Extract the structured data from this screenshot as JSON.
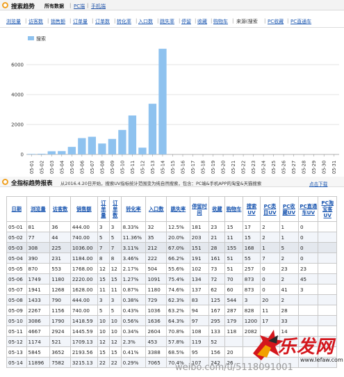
{
  "header": {
    "title": "搜索趋势",
    "sub_all": "所有数据",
    "sub_pc": "PC端",
    "sub_mobile": "手机端",
    "sep": "|"
  },
  "tabs": [
    {
      "label": "浏览量",
      "active": false
    },
    {
      "label": "访客数",
      "active": false
    },
    {
      "label": "销售额",
      "active": false
    },
    {
      "label": "订单量",
      "active": false
    },
    {
      "label": "订单数",
      "active": false
    },
    {
      "label": "转化率",
      "active": false
    },
    {
      "label": "入口数",
      "active": false
    },
    {
      "label": "跳失率",
      "active": false
    },
    {
      "label": "停留",
      "active": false
    },
    {
      "label": "收藏",
      "active": false
    },
    {
      "label": "购物车",
      "active": false
    },
    {
      "label": "来源(搜索",
      "active": true
    },
    {
      "label": "PC收藏",
      "active": false
    },
    {
      "label": "PC直通车",
      "active": false
    }
  ],
  "chart_data": {
    "type": "bar",
    "legend": [
      "搜索"
    ],
    "legend_position": "top-left",
    "ylim": [
      0,
      8000
    ],
    "yticks": [
      0,
      2000,
      4000,
      6000
    ],
    "grid": true,
    "bar_color": "#8ec2ef",
    "categories": [
      "05-01",
      "05-02",
      "05-03",
      "05-04",
      "05-05",
      "05-06",
      "05-07",
      "05-08",
      "05-09",
      "05-10",
      "05-11",
      "05-12",
      "05-13",
      "05-14",
      "05-15",
      "05-16",
      "05-17",
      "05-18",
      "05-19",
      "05-20",
      "05-21",
      "05-22",
      "05-23",
      "05-24",
      "05-25",
      "05-26",
      "05-27",
      "05-28",
      "05-29",
      "05-30",
      "05-31"
    ],
    "values": [
      32,
      44,
      212,
      222,
      504,
      1091,
      1180,
      729,
      1036,
      1636,
      2604,
      453,
      3388,
      7065,
      0,
      0,
      0,
      0,
      0,
      0,
      0,
      0,
      0,
      0,
      0,
      0,
      0,
      0,
      0,
      0,
      0
    ]
  },
  "section2": {
    "title": "全指标趋势报表",
    "note": "从2016.4.20日开始，搜索UV指标统计范围变为纯自然搜索，包含：PC端&手机APP的淘宝&天猫搜索",
    "download": "点击下载"
  },
  "table": {
    "headers": [
      "日期",
      "浏览量",
      "访客数",
      "销售额",
      "订单量",
      "订单数",
      "转化率",
      "入口数",
      "跳失率",
      "停留时间",
      "收藏",
      "购物车",
      "搜索UV",
      "PC类目UV",
      "PC收藏UV",
      "PC直通车UV",
      "PC淘宝客UV"
    ],
    "rows": [
      [
        "05-01",
        "81",
        "36",
        "444.00",
        "3",
        "3",
        "8.33%",
        "32",
        "12.5%",
        "181",
        "23",
        "15",
        "17",
        "2",
        "1",
        "0"
      ],
      [
        "05-02",
        "77",
        "44",
        "740.00",
        "5",
        "5",
        "11.36%",
        "35",
        "20.0%",
        "203",
        "21",
        "11",
        "15",
        "2",
        "1",
        "0"
      ],
      [
        "05-03",
        "308",
        "225",
        "1036.00",
        "7",
        "7",
        "3.11%",
        "212",
        "67.0%",
        "151",
        "28",
        "155",
        "168",
        "1",
        "5",
        "0"
      ],
      [
        "05-04",
        "390",
        "231",
        "1184.00",
        "8",
        "8",
        "3.46%",
        "222",
        "66.2%",
        "191",
        "161",
        "51",
        "55",
        "7",
        "2",
        "0"
      ],
      [
        "05-05",
        "870",
        "553",
        "1768.00",
        "12",
        "12",
        "2.17%",
        "504",
        "55.6%",
        "102",
        "73",
        "51",
        "257",
        "0",
        "23",
        "23"
      ],
      [
        "05-06",
        "1749",
        "1180",
        "2220.00",
        "15",
        "15",
        "1.27%",
        "1091",
        "75.4%",
        "134",
        "72",
        "70",
        "873",
        "0",
        "2",
        "45"
      ],
      [
        "05-07",
        "1941",
        "1268",
        "1628.00",
        "11",
        "11",
        "0.87%",
        "1180",
        "74.6%",
        "137",
        "62",
        "60",
        "873",
        "0",
        "41",
        "3"
      ],
      [
        "05-08",
        "1433",
        "790",
        "444.00",
        "3",
        "3",
        "0.38%",
        "729",
        "62.3%",
        "83",
        "125",
        "544",
        "3",
        "20",
        "2",
        ""
      ],
      [
        "05-09",
        "2267",
        "1156",
        "740.00",
        "5",
        "5",
        "0.43%",
        "1036",
        "63.2%",
        "94",
        "167",
        "287",
        "828",
        "11",
        "28",
        ""
      ],
      [
        "05-10",
        "3086",
        "1790",
        "1418.59",
        "10",
        "10",
        "0.56%",
        "1636",
        "64.3%",
        "97",
        "295",
        "179",
        "1200",
        "17",
        "33",
        ""
      ],
      [
        "05-11",
        "4667",
        "2924",
        "1445.59",
        "10",
        "10",
        "0.34%",
        "2604",
        "70.8%",
        "108",
        "133",
        "118",
        "2082",
        "",
        "14",
        ""
      ],
      [
        "05-12",
        "1174",
        "521",
        "1709.13",
        "12",
        "12",
        "2.3%",
        "453",
        "57.8%",
        "119",
        "52",
        "",
        "",
        "",
        "",
        "",
        ""
      ],
      [
        "05-13",
        "5845",
        "3652",
        "2193.56",
        "15",
        "15",
        "0.41%",
        "3388",
        "68.5%",
        "95",
        "156",
        "20",
        "",
        "",
        "",
        "",
        ""
      ],
      [
        "05-14",
        "11896",
        "7582",
        "3215.13",
        "22",
        "22",
        "0.29%",
        "7065",
        "70.4%",
        "107",
        "242",
        "26",
        "",
        "",
        "",
        "",
        ""
      ]
    ]
  },
  "watermark": {
    "brand": "乐发网",
    "url": "www.lefaw.com",
    "blog": "weibo.com/u/5118091001"
  }
}
